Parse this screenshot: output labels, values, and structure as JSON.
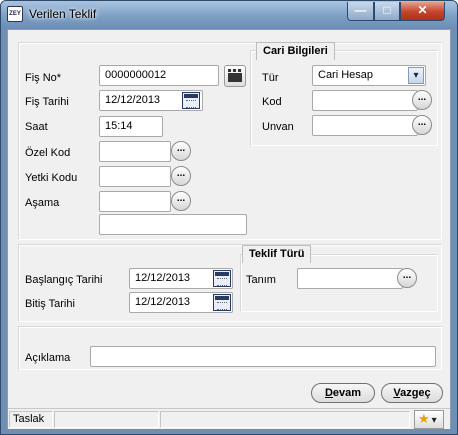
{
  "window": {
    "title": "Verilen Teklif",
    "app_icon": "ZEY",
    "controls": {
      "minimize": "—",
      "maximize": "□",
      "close": "✕"
    }
  },
  "form": {
    "fis_no": {
      "label": "Fiş No*",
      "value": "0000000012"
    },
    "fis_tarihi": {
      "label": "Fiş Tarihi",
      "value": "12/12/2013"
    },
    "saat": {
      "label": "Saat",
      "value": "15:14"
    },
    "ozel_kod": {
      "label": "Özel Kod",
      "value": ""
    },
    "yetki_kodu": {
      "label": "Yetki Kodu",
      "value": ""
    },
    "asama": {
      "label": "Aşama",
      "value": ""
    },
    "asama_desc": {
      "value": ""
    }
  },
  "cari": {
    "group_title": "Cari Bilgileri",
    "tur": {
      "label": "Tür",
      "value": "Cari Hesap"
    },
    "kod": {
      "label": "Kod",
      "value": ""
    },
    "unvan": {
      "label": "Unvan",
      "value": ""
    }
  },
  "dates": {
    "baslangic": {
      "label": "Başlangıç Tarihi",
      "value": "12/12/2013"
    },
    "bitis": {
      "label": "Bitiş Tarihi",
      "value": "12/12/2013"
    }
  },
  "teklif": {
    "group_title": "Teklif Türü",
    "tanim": {
      "label": "Tanım",
      "value": ""
    }
  },
  "aciklama": {
    "label": "Açıklama",
    "value": ""
  },
  "buttons": {
    "devam": {
      "first": "D",
      "rest": "evam"
    },
    "vazgec": {
      "first": "V",
      "rest": "azgeç"
    },
    "ellipsis": "..."
  },
  "status": {
    "state": "Taslak",
    "star": "★",
    "dropdown": "▾"
  }
}
